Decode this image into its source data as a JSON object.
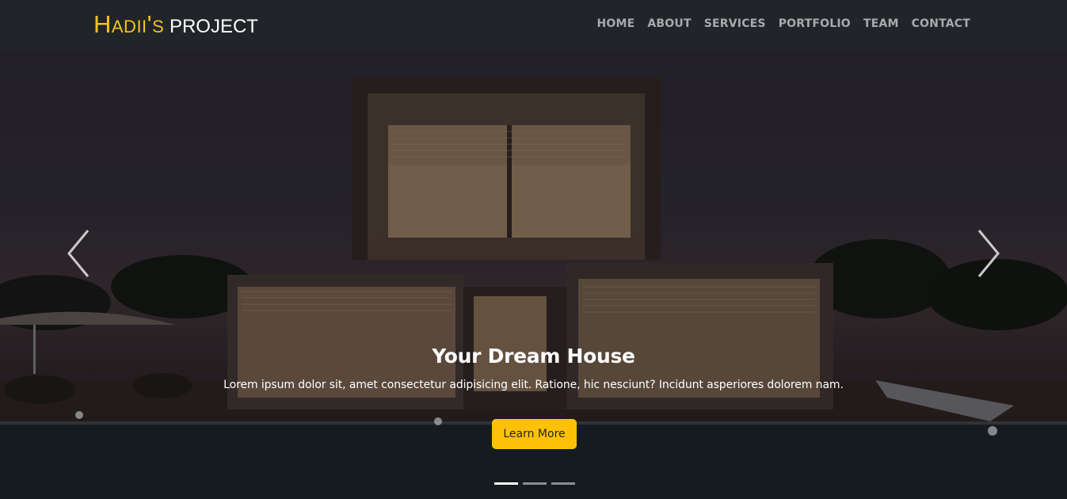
{
  "brand": {
    "accent": "Hadii's",
    "rest": "PROJECT"
  },
  "nav": {
    "links": [
      "HOME",
      "ABOUT",
      "SERVICES",
      "PORTFOLIO",
      "TEAM",
      "CONTACT"
    ]
  },
  "hero": {
    "title": "Your Dream House",
    "text": "Lorem ipsum dolor sit, amet consectetur adipisicing elit. Ratione, hic nesciunt? Incidunt asperiores dolorem nam.",
    "button_label": "Learn More",
    "slide_count": 3,
    "active_slide": 1
  },
  "colors": {
    "accent": "#ffc107",
    "navbar_bg": "#212529",
    "nav_link": "#a8aaad"
  },
  "icons": {
    "prev": "chevron-left-icon",
    "next": "chevron-right-icon"
  }
}
